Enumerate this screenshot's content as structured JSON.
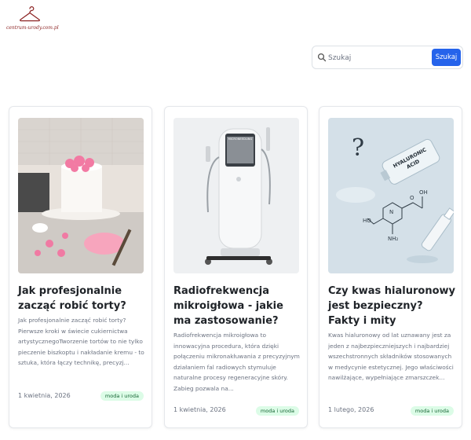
{
  "site": {
    "logo_text": "centrum-urody.com.pl",
    "logo_icon": "hanger-icon",
    "brand_color": "#8a1f1f"
  },
  "search": {
    "placeholder": "Szukaj",
    "value": "",
    "button_label": "Szukaj",
    "accent_color": "#2563eb"
  },
  "articles": [
    {
      "title": "Jak profesjonalnie zacząć robić torty?",
      "excerpt": "Jak profesjonalnie zacząć robić torty? Pierwsze kroki w świecie cukiernictwa artystycznegoTworzenie tortów to nie tylko pieczenie biszkoptu i nakładanie kremu - to sztuka, która łączy technikę, precyzj...",
      "date": "1 kwietnia, 2026",
      "category": "moda i uroda"
    },
    {
      "title": "Radiofrekwencja mikroigłowa - jakie ma zastosowanie?",
      "excerpt": "Radiofrekwencja mikroigłowa to innowacyjna procedura, która dzięki połączeniu mikronakłuwania z precyzyjnym działaniem fal radiowych stymuluje naturalne procesy regeneracyjne skóry. Zabieg pozwala na...",
      "date": "1 kwietnia, 2026",
      "category": "moda i uroda",
      "image_text": "MICRONEEDLING"
    },
    {
      "title": "Czy kwas hialuronowy jest bezpieczny? Fakty i mity",
      "excerpt": "Kwas hialuronowy od lat uznawany jest za jeden z najbezpieczniejszych i najbardziej wszechstronnych składników stosowanych w medycynie estetycznej. Jego właściwości nawilżające, wypełniające zmarszczek...",
      "date": "1 lutego, 2026",
      "category": "moda i uroda",
      "image_text": "HYALURONIC ACID"
    }
  ]
}
